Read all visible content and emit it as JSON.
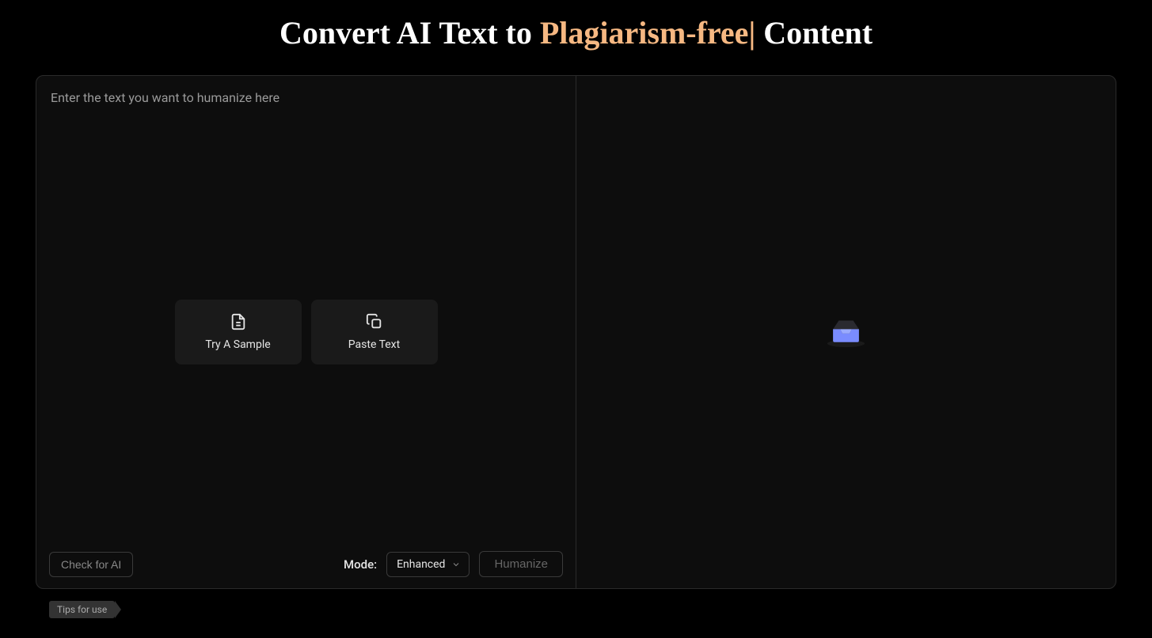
{
  "title": {
    "prefix": "Convert AI Text to ",
    "highlight": "Plagiarism-free",
    "suffix": " Content"
  },
  "input": {
    "placeholder": "Enter the text you want to humanize here"
  },
  "actions": {
    "try_sample": "Try A Sample",
    "paste_text": "Paste Text"
  },
  "bottom": {
    "check_ai": "Check for AI",
    "mode_label": "Mode:",
    "mode_value": "Enhanced",
    "humanize": "Humanize"
  },
  "tips_label": "Tips for use"
}
